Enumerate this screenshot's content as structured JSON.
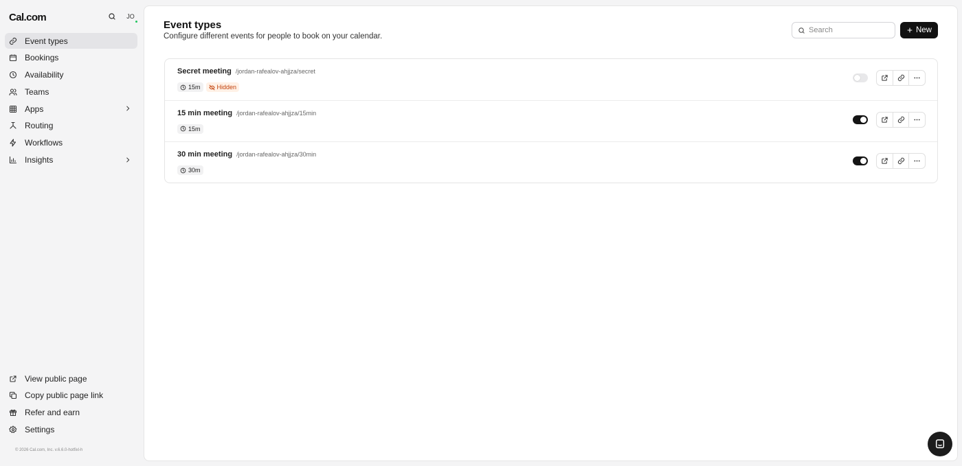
{
  "app": {
    "logo": "Cal.com",
    "avatar_initials": "JO"
  },
  "sidebar": {
    "items": [
      {
        "label": "Event types",
        "icon": "link-icon",
        "active": true
      },
      {
        "label": "Bookings",
        "icon": "calendar-icon"
      },
      {
        "label": "Availability",
        "icon": "clock-icon"
      },
      {
        "label": "Teams",
        "icon": "users-icon"
      },
      {
        "label": "Apps",
        "icon": "grid-icon",
        "expandable": true
      },
      {
        "label": "Routing",
        "icon": "split-icon"
      },
      {
        "label": "Workflows",
        "icon": "zap-icon"
      },
      {
        "label": "Insights",
        "icon": "chart-icon",
        "expandable": true
      }
    ],
    "bottom_items": [
      {
        "label": "View public page",
        "icon": "external-link-icon"
      },
      {
        "label": "Copy public page link",
        "icon": "copy-icon"
      },
      {
        "label": "Refer and earn",
        "icon": "gift-icon"
      },
      {
        "label": "Settings",
        "icon": "gear-icon"
      }
    ],
    "copyright": "© 2026 Cal.com, Inc. v.6.6.0-hotfixl-h"
  },
  "header": {
    "title": "Event types",
    "subtitle": "Configure different events for people to book on your calendar.",
    "search_placeholder": "Search",
    "new_label": "New"
  },
  "events": [
    {
      "title": "Secret meeting",
      "slug": "/jordan-rafealov-ahjjza/secret",
      "duration": "15m",
      "hidden_label": "Hidden",
      "enabled": false
    },
    {
      "title": "15 min meeting",
      "slug": "/jordan-rafealov-ahjjza/15min",
      "duration": "15m",
      "enabled": true
    },
    {
      "title": "30 min meeting",
      "slug": "/jordan-rafealov-ahjjza/30min",
      "duration": "30m",
      "enabled": true
    }
  ],
  "colors": {
    "accent": "#111111",
    "hidden_badge": "#c2410c",
    "online_dot": "#22c55e"
  }
}
